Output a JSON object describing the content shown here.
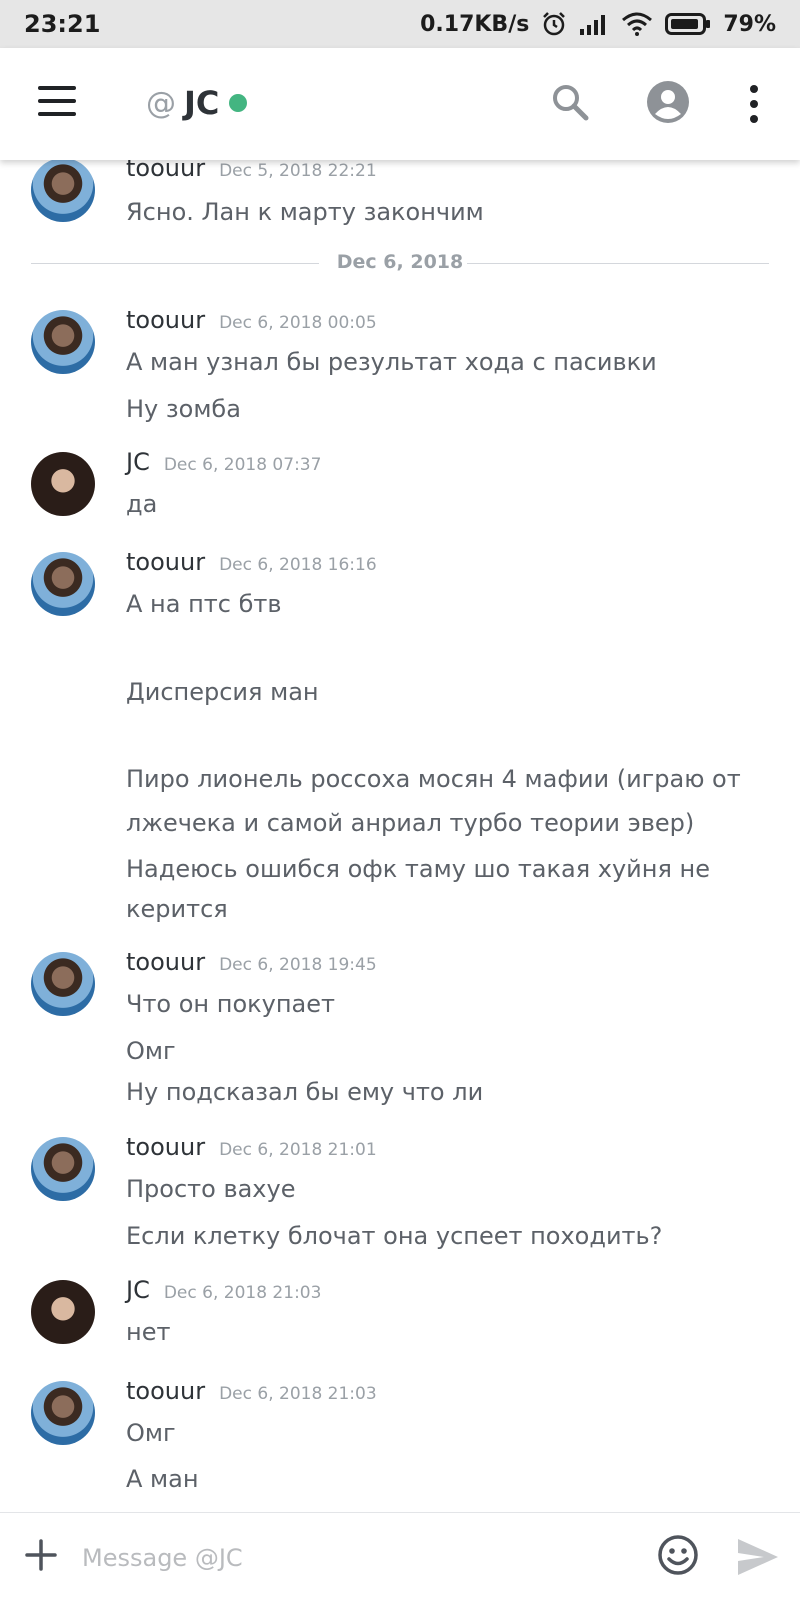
{
  "status_bar": {
    "time": "23:21",
    "net_speed": "0.17KB/s",
    "battery": "79%"
  },
  "header": {
    "at": "@",
    "title": "JC",
    "status_color": "#43b581"
  },
  "date_divider": "Dec 6, 2018",
  "messages": [
    {
      "author": "toouur",
      "timestamp": "Dec 5, 2018 22:21",
      "lines": [
        "Ясно. Лан к марту закончим"
      ]
    },
    {
      "author": "toouur",
      "timestamp": "Dec 6, 2018 00:05",
      "lines": [
        "А ман узнал бы результат хода с пасивки",
        "Ну зомба"
      ]
    },
    {
      "author": "JC",
      "timestamp": "Dec 6, 2018 07:37",
      "lines": [
        "да"
      ]
    },
    {
      "author": "toouur",
      "timestamp": "Dec 6, 2018 16:16",
      "lines": [
        "А на птс бтв",
        "Дисперсия ман",
        "Пиро лионель россоха мосян 4 мафии (играю от",
        "лжечека и самой анриал турбо теории эвер)",
        "Надеюсь ошибся офк таму шо такая хуйня не",
        "керится"
      ]
    },
    {
      "author": "toouur",
      "timestamp": "Dec 6, 2018 19:45",
      "lines": [
        "Что он покупает",
        "Омг",
        "Ну подсказал бы ему что ли"
      ]
    },
    {
      "author": "toouur",
      "timestamp": "Dec 6, 2018 21:01",
      "lines": [
        "Просто вахуе",
        "Если клетку блочат она успеет походить?"
      ]
    },
    {
      "author": "JC",
      "timestamp": "Dec 6, 2018 21:03",
      "lines": [
        "нет"
      ]
    },
    {
      "author": "toouur",
      "timestamp": "Dec 6, 2018 21:03",
      "lines": [
        "Омг",
        "А ман"
      ]
    }
  ],
  "composer": {
    "placeholder": "Message @JC"
  }
}
